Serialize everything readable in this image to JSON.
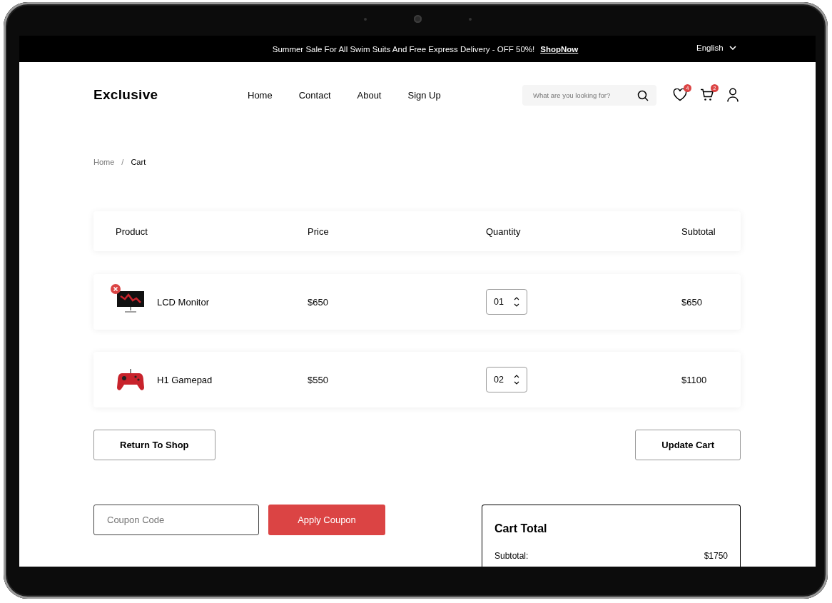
{
  "top_bar": {
    "message": "Summer Sale For All Swim Suits And Free Express Delivery - OFF 50%!",
    "link": "ShopNow",
    "language": "English"
  },
  "header": {
    "logo": "Exclusive",
    "nav": [
      {
        "label": "Home"
      },
      {
        "label": "Contact"
      },
      {
        "label": "About"
      },
      {
        "label": "Sign Up"
      }
    ],
    "search": {
      "placeholder": "What are you looking for?"
    },
    "wishlist_count": "4",
    "cart_count": "2"
  },
  "breadcrumb_separator": "/",
  "breadcrumb": [
    {
      "label": "Home",
      "current": false
    },
    {
      "label": "Cart",
      "current": true
    }
  ],
  "table": {
    "columns": [
      "Product",
      "Price",
      "Quantity",
      "Subtotal"
    ],
    "rows": [
      {
        "kind": "monitor",
        "name": "LCD Monitor",
        "price": "$650",
        "quantity": "01",
        "subtotal": "$650",
        "remove_shown": true
      },
      {
        "kind": "gamepad",
        "name": "H1 Gamepad",
        "price": "$550",
        "quantity": "02",
        "subtotal": "$1100",
        "remove_shown": false
      }
    ]
  },
  "actions": {
    "return": "Return To Shop",
    "update": "Update Cart"
  },
  "coupon": {
    "placeholder": "Coupon Code",
    "apply": "Apply Coupon"
  },
  "cart_total": {
    "title": "Cart Total",
    "lines": [
      {
        "label": "Subtotal:",
        "value": "$1750"
      }
    ]
  }
}
